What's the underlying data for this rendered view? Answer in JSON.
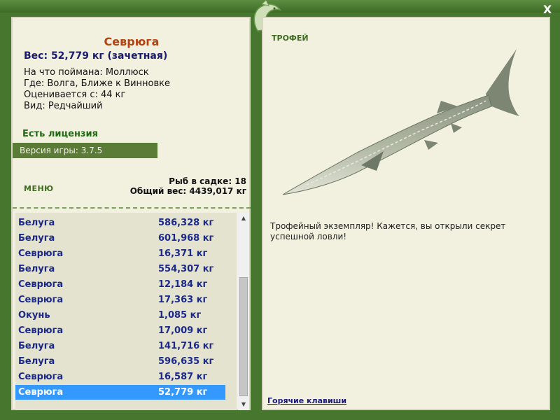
{
  "fish": {
    "name": "Севрюга",
    "weight": "Вес: 52,779 кг (зачетная)",
    "caught_on": "На что поймана: Моллюск",
    "location": "Где: Волга, Ближе к Винновке",
    "rated_from": "Оценивается с: 44 кг",
    "type": "Вид: Редчайший"
  },
  "license": "Есть лицензия",
  "version": "Версия игры: 3.7.5",
  "menu_label": "МЕНЮ",
  "stats": {
    "fish_in_net": "Рыб в садке: 18",
    "total_weight": "Общий вес: 4439,017 кг"
  },
  "catch_list": [
    {
      "name": "Белуга",
      "weight": "586,328 кг"
    },
    {
      "name": "Белуга",
      "weight": "601,968 кг"
    },
    {
      "name": "Севрюга",
      "weight": "16,371 кг"
    },
    {
      "name": "Белуга",
      "weight": "554,307 кг"
    },
    {
      "name": "Севрюга",
      "weight": "12,184 кг"
    },
    {
      "name": "Севрюга",
      "weight": "17,363 кг"
    },
    {
      "name": "Окунь",
      "weight": "1,085 кг"
    },
    {
      "name": "Севрюга",
      "weight": "17,009 кг"
    },
    {
      "name": "Белуга",
      "weight": "141,716 кг"
    },
    {
      "name": "Белуга",
      "weight": "596,635 кг"
    },
    {
      "name": "Севрюга",
      "weight": "16,587 кг"
    },
    {
      "name": "Севрюга",
      "weight": "52,779 кг",
      "selected": true
    }
  ],
  "trophy_label": "ТРОФЕЙ",
  "trophy_text": "Трофейный экземпляр! Кажется, вы открыли секрет успешной ловли!",
  "hotkeys_label": "Горячие клавиши",
  "close_label": "X",
  "icons": {
    "close": "close-icon",
    "logo": "fish-logo-icon",
    "scroll_up": "scroll-up-icon",
    "scroll_down": "scroll-down-icon"
  },
  "colors": {
    "frame_green": "#47772f",
    "panel_bg": "#f2f1e0",
    "title_orange": "#b5420f",
    "list_text_blue": "#1b2a8a",
    "selection_blue": "#3399ff",
    "license_green": "#1f6b12"
  }
}
